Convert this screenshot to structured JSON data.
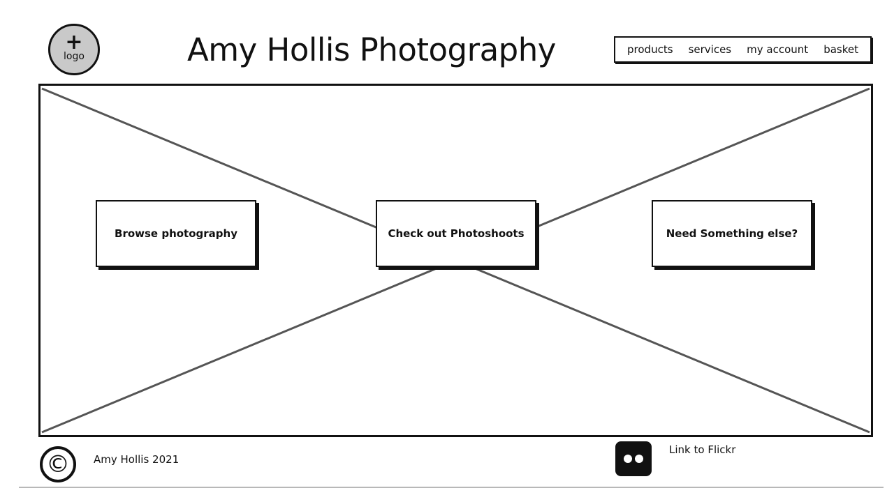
{
  "header": {
    "logo_symbol": "+",
    "logo_label": "logo",
    "title": "Amy Hollis Photography"
  },
  "nav": {
    "items": [
      {
        "label": "products"
      },
      {
        "label": "services"
      },
      {
        "label": "my account"
      },
      {
        "label": "basket"
      }
    ]
  },
  "hero": {
    "buttons": [
      {
        "label": "Browse photography"
      },
      {
        "label": "Check out Photoshoots"
      },
      {
        "label": "Need Something else?"
      }
    ]
  },
  "footer": {
    "copyright_symbol": "©",
    "copyright_text": "Amy Hollis 2021",
    "flickr_icon": "flickr-icon",
    "flickr_link": "Link to Flickr"
  },
  "colors": {
    "line": "#111111",
    "placeholder_cross": "#555555",
    "logo_fill": "#c9c9c9",
    "rule": "#b8b8b8"
  }
}
